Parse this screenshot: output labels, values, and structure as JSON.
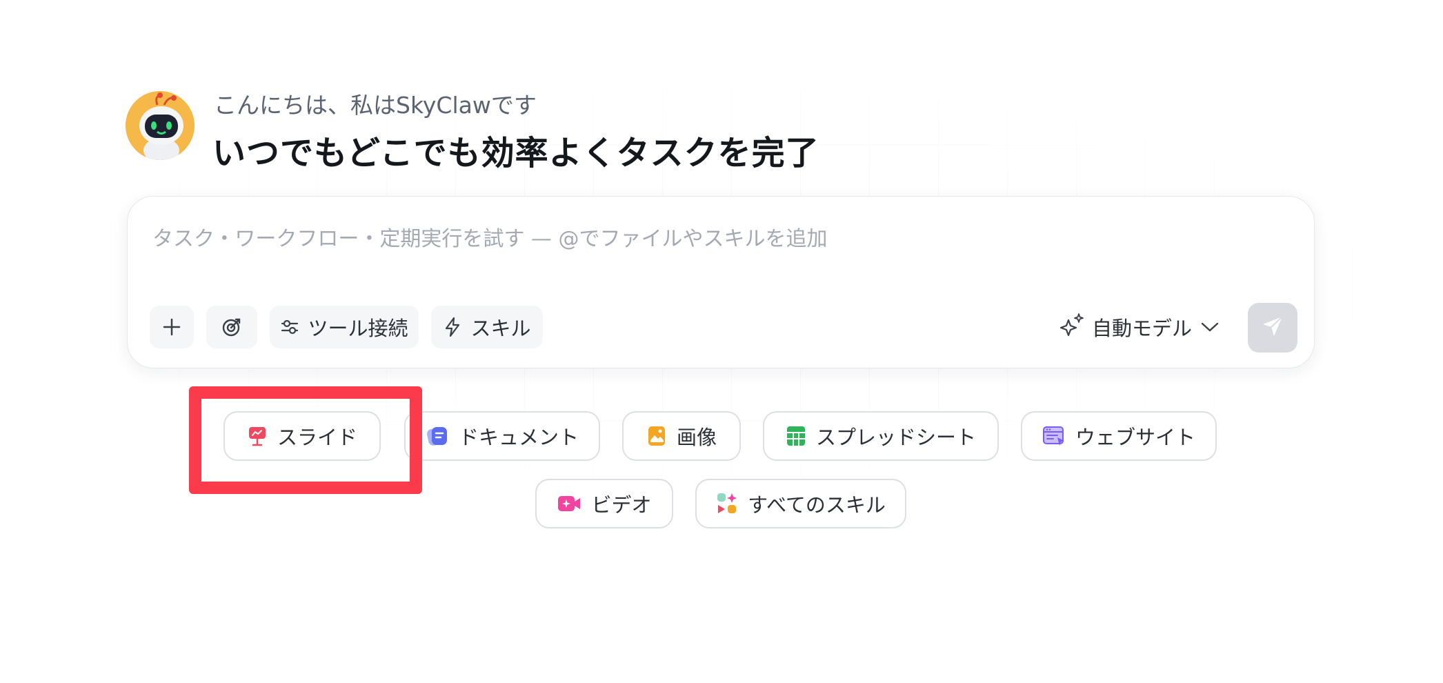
{
  "greeting": {
    "subtitle": "こんにちは、私はSkyClawです",
    "title": "いつでもどこでも効率よくタスクを完了"
  },
  "composer": {
    "placeholder": "タスク・ワークフロー・定期実行を試す — @でファイルやスキルを追加",
    "value": "",
    "tools": {
      "add_icon": "plus-icon",
      "target_icon": "target-icon",
      "connect_label": "ツール接続",
      "skill_label": "スキル"
    },
    "model_label": "自動モデル",
    "send_icon": "paper-plane-icon"
  },
  "chips": {
    "slides": "スライド",
    "documents": "ドキュメント",
    "images": "画像",
    "spreadsheet": "スプレッドシート",
    "website": "ウェブサイト",
    "video": "ビデオ",
    "all_skills": "すべてのスキル"
  },
  "colors": {
    "highlight": "#fb3a4b",
    "slides_icon": "#f0485f",
    "documents_icon": "#5b6cf0",
    "images_icon": "#f4a623",
    "spreadsheet_icon": "#2fb45b",
    "website_icon": "#7a5cf0",
    "video_icon": "#f0449e",
    "send_button": "#d9dbe0"
  }
}
